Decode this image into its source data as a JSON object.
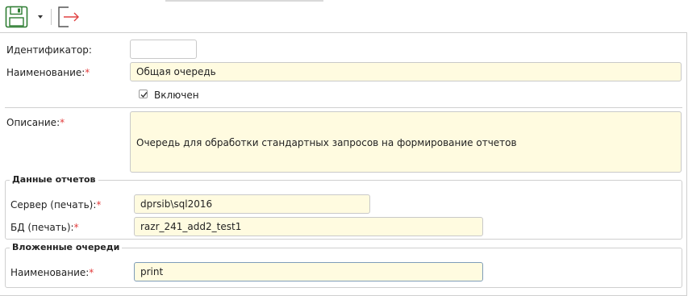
{
  "toolbar": {
    "save_icon": "floppy-disk-icon",
    "menu_caret": "dropdown-caret-icon",
    "exit_icon": "exit-arrow-icon"
  },
  "form": {
    "identifier": {
      "label": "Идентификатор:",
      "value": ""
    },
    "name": {
      "label": "Наименование:",
      "required": "*",
      "value": "Общая очередь"
    },
    "enabled": {
      "label": "Включен",
      "checked": true
    },
    "description": {
      "label": "Описание:",
      "required": "*",
      "value": "Очередь для обработки стандартных запросов на формирование отчетов"
    }
  },
  "report_data": {
    "title": "Данные отчетов",
    "server": {
      "label": "Сервер (печать):",
      "required": "*",
      "value": "dprsib\\sql2016"
    },
    "db": {
      "label": "БД (печать):",
      "required": "*",
      "value": "razr_241_add2_test1"
    }
  },
  "nested_queues": {
    "title": "Вложенные очереди",
    "name": {
      "label": "Наименование:",
      "required": "*",
      "value": "print"
    }
  }
}
